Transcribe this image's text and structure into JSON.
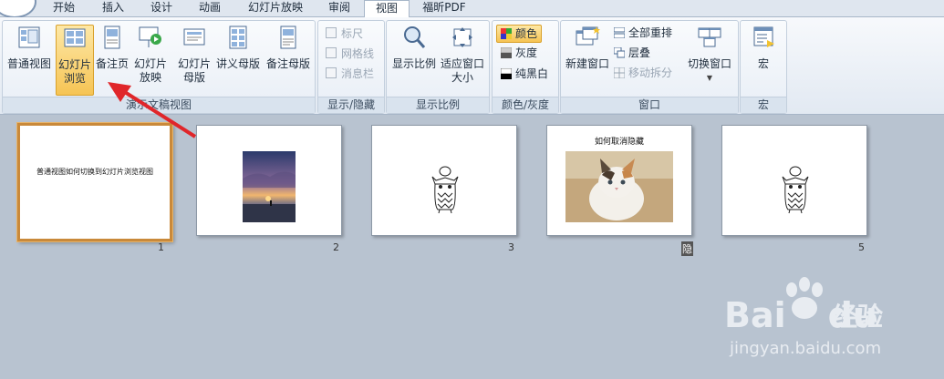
{
  "tabs": [
    "开始",
    "插入",
    "设计",
    "动画",
    "幻灯片放映",
    "审阅",
    "视图",
    "福昕PDF"
  ],
  "active_tab": "视图",
  "groups": {
    "presentation_views": {
      "label": "演示文稿视图",
      "buttons": [
        "普通视图",
        "幻灯片浏览",
        "备注页",
        "幻灯片放映",
        "幻灯片母版",
        "讲义母版",
        "备注母版"
      ]
    },
    "show_hide": {
      "label": "显示/隐藏",
      "items": [
        "标尺",
        "网格线",
        "消息栏"
      ]
    },
    "zoom": {
      "label": "显示比例",
      "buttons": [
        "显示比例",
        "适应窗口大小"
      ]
    },
    "color": {
      "label": "颜色/灰度",
      "items": [
        "颜色",
        "灰度",
        "纯黑白"
      ]
    },
    "window": {
      "label": "窗口",
      "buttons": [
        "新建窗口",
        "全部重排",
        "层叠",
        "移动拆分",
        "切换窗口"
      ]
    },
    "macro": {
      "label": "宏",
      "buttons": [
        "宏"
      ]
    }
  },
  "slides": [
    {
      "number": "1",
      "title": "普通视图如何切换到幻灯片浏览视图"
    },
    {
      "number": "2",
      "title": ""
    },
    {
      "number": "3",
      "title": ""
    },
    {
      "number": "4",
      "title": "如何取消隐藏",
      "number_mark": "隐"
    },
    {
      "number": "5",
      "title": ""
    }
  ],
  "watermark": {
    "brand": "Bai",
    "brand2": "du",
    "cn": "经验",
    "url": "jingyan.baidu.com"
  },
  "colors": {
    "accent": "#f6c454",
    "selection_border": "#c9893a",
    "arrow": "#e0262a",
    "workspace": "#b8c3d0"
  }
}
